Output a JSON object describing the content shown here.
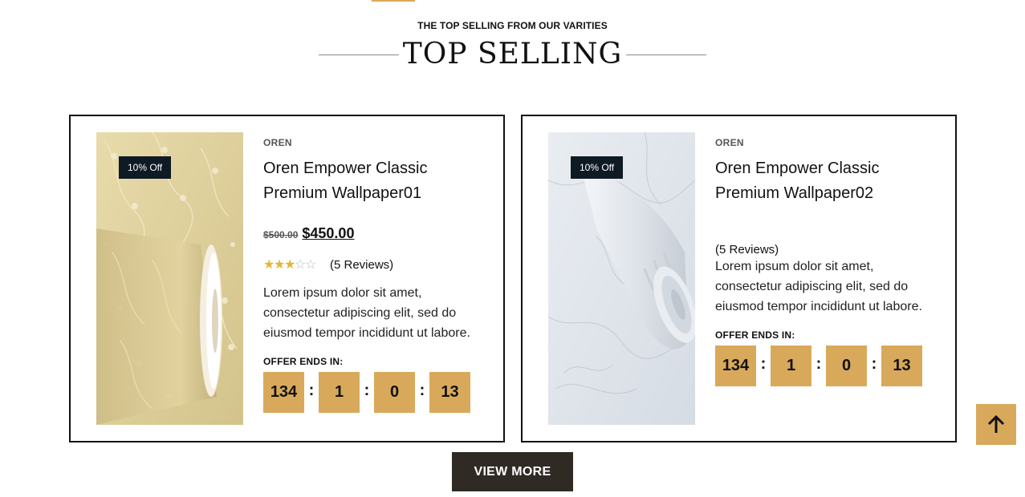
{
  "section": {
    "subtitle": "THE TOP SELLING FROM OUR VARITIES",
    "title": "TOP SELLING"
  },
  "products": [
    {
      "badge": "10% Off",
      "brand": "OREN",
      "name": "Oren Empower Classic Premium Wallpaper01",
      "old_price": "$500.00",
      "price": "$450.00",
      "rating": 3,
      "rating_max": 5,
      "reviews": "(5 Reviews)",
      "description": "Lorem ipsum dolor sit amet, consectetur adipiscing elit, sed do eiusmod tempor incididunt ut labore.",
      "offer_label": "OFFER ENDS IN:",
      "timer": [
        "134",
        "1",
        "0",
        "13"
      ],
      "image_icon": "wallpaper-roll-beige-floral"
    },
    {
      "badge": "10% Off",
      "brand": "OREN",
      "name": "Oren Empower Classic Premium Wallpaper02",
      "reviews": "(5 Reviews)",
      "description": "Lorem ipsum dolor sit amet, consectetur adipiscing elit, sed do eiusmod tempor incididunt ut labore.",
      "offer_label": "OFFER ENDS IN:",
      "timer": [
        "134",
        "1",
        "0",
        "13"
      ],
      "image_icon": "wallpaper-roll-white-marble"
    }
  ],
  "timer_separator": ":",
  "view_more_label": "VIEW MORE",
  "back_to_top_icon": "arrow-up-icon",
  "colors": {
    "accent": "#d9a95b",
    "badge_bg": "#0e1a24",
    "button_bg": "#2f2a24",
    "star": "#e3b82f"
  }
}
